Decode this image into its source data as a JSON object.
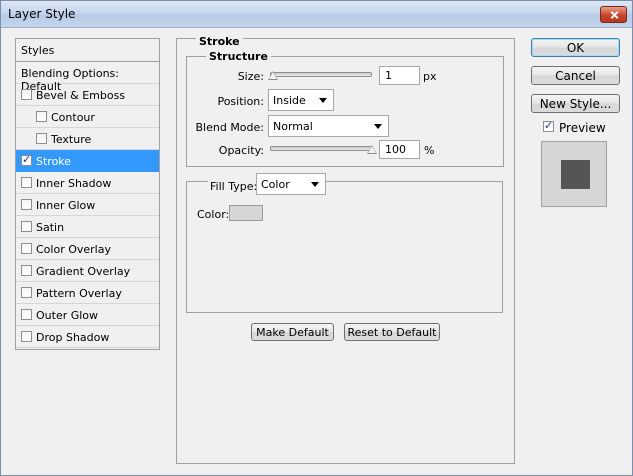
{
  "window": {
    "title": "Layer Style"
  },
  "styles_panel": {
    "header": "Styles",
    "blending_options": "Blending Options: Default",
    "items": [
      {
        "label": "Bevel & Emboss",
        "checked": false,
        "indent": 0
      },
      {
        "label": "Contour",
        "checked": false,
        "indent": 1
      },
      {
        "label": "Texture",
        "checked": false,
        "indent": 1
      },
      {
        "label": "Stroke",
        "checked": true,
        "indent": 0,
        "selected": true
      },
      {
        "label": "Inner Shadow",
        "checked": false,
        "indent": 0
      },
      {
        "label": "Inner Glow",
        "checked": false,
        "indent": 0
      },
      {
        "label": "Satin",
        "checked": false,
        "indent": 0
      },
      {
        "label": "Color Overlay",
        "checked": false,
        "indent": 0
      },
      {
        "label": "Gradient Overlay",
        "checked": false,
        "indent": 0
      },
      {
        "label": "Pattern Overlay",
        "checked": false,
        "indent": 0
      },
      {
        "label": "Outer Glow",
        "checked": false,
        "indent": 0
      },
      {
        "label": "Drop Shadow",
        "checked": false,
        "indent": 0
      }
    ]
  },
  "stroke": {
    "title": "Stroke",
    "structure": {
      "title": "Structure",
      "size_label": "Size:",
      "size_value": "1",
      "size_unit": "px",
      "size_fraction": 0.0,
      "position_label": "Position:",
      "position_value": "Inside",
      "blend_mode_label": "Blend Mode:",
      "blend_mode_value": "Normal",
      "opacity_label": "Opacity:",
      "opacity_value": "100",
      "opacity_unit": "%",
      "opacity_fraction": 1.0
    },
    "fill": {
      "fill_type_label": "Fill Type:",
      "fill_type_value": "Color",
      "color_label": "Color:",
      "color_value": "#d6d6d6"
    },
    "make_default": "Make Default",
    "reset_default": "Reset to Default"
  },
  "actions": {
    "ok": "OK",
    "cancel": "Cancel",
    "new_style": "New Style...",
    "preview_label": "Preview",
    "preview_checked": true,
    "preview_color": "#555555"
  },
  "icons": {
    "close": "close-icon",
    "checkbox": "checkmark-icon",
    "dropdown": "chevron-down-icon"
  }
}
